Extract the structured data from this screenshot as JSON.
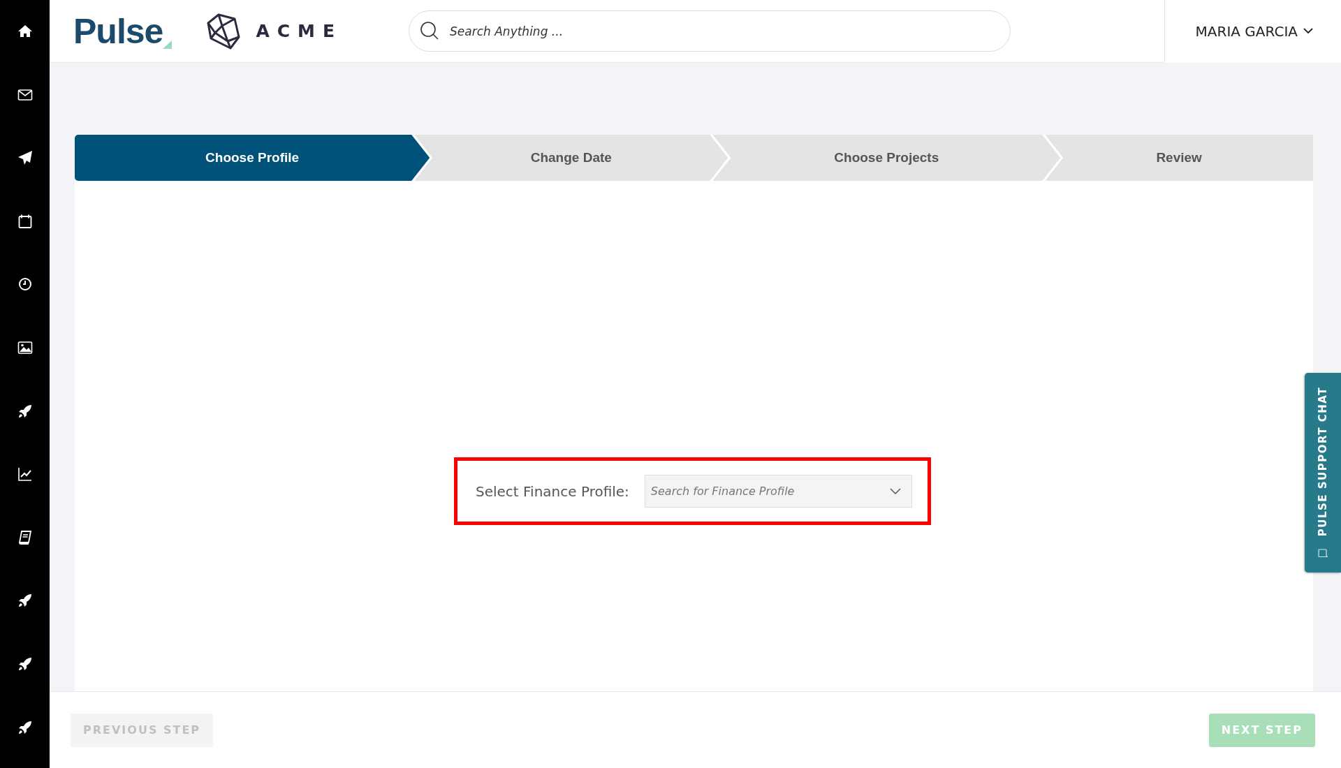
{
  "header": {
    "logo": "Pulse",
    "brand": "ACME",
    "search": {
      "placeholder": "Search Anything ..."
    },
    "user": "MARIA GARCIA"
  },
  "steps": [
    {
      "label": "Choose Profile",
      "selected": true
    },
    {
      "label": "Change Date",
      "selected": false
    },
    {
      "label": "Choose Projects",
      "selected": false
    },
    {
      "label": "Review",
      "selected": false
    }
  ],
  "form": {
    "label": "Select Finance Profile:",
    "select": {
      "placeholder": "Search for Finance Profile"
    },
    "highlighted": true
  },
  "support_chat": {
    "label": "PULSE SUPPORT CHAT"
  },
  "footer": {
    "buttons": [
      {
        "label": "PREVIOUS STEP",
        "kind": "previous",
        "disabled": true
      },
      {
        "label": "NEXT STEP",
        "kind": "next",
        "disabled": true
      }
    ]
  }
}
